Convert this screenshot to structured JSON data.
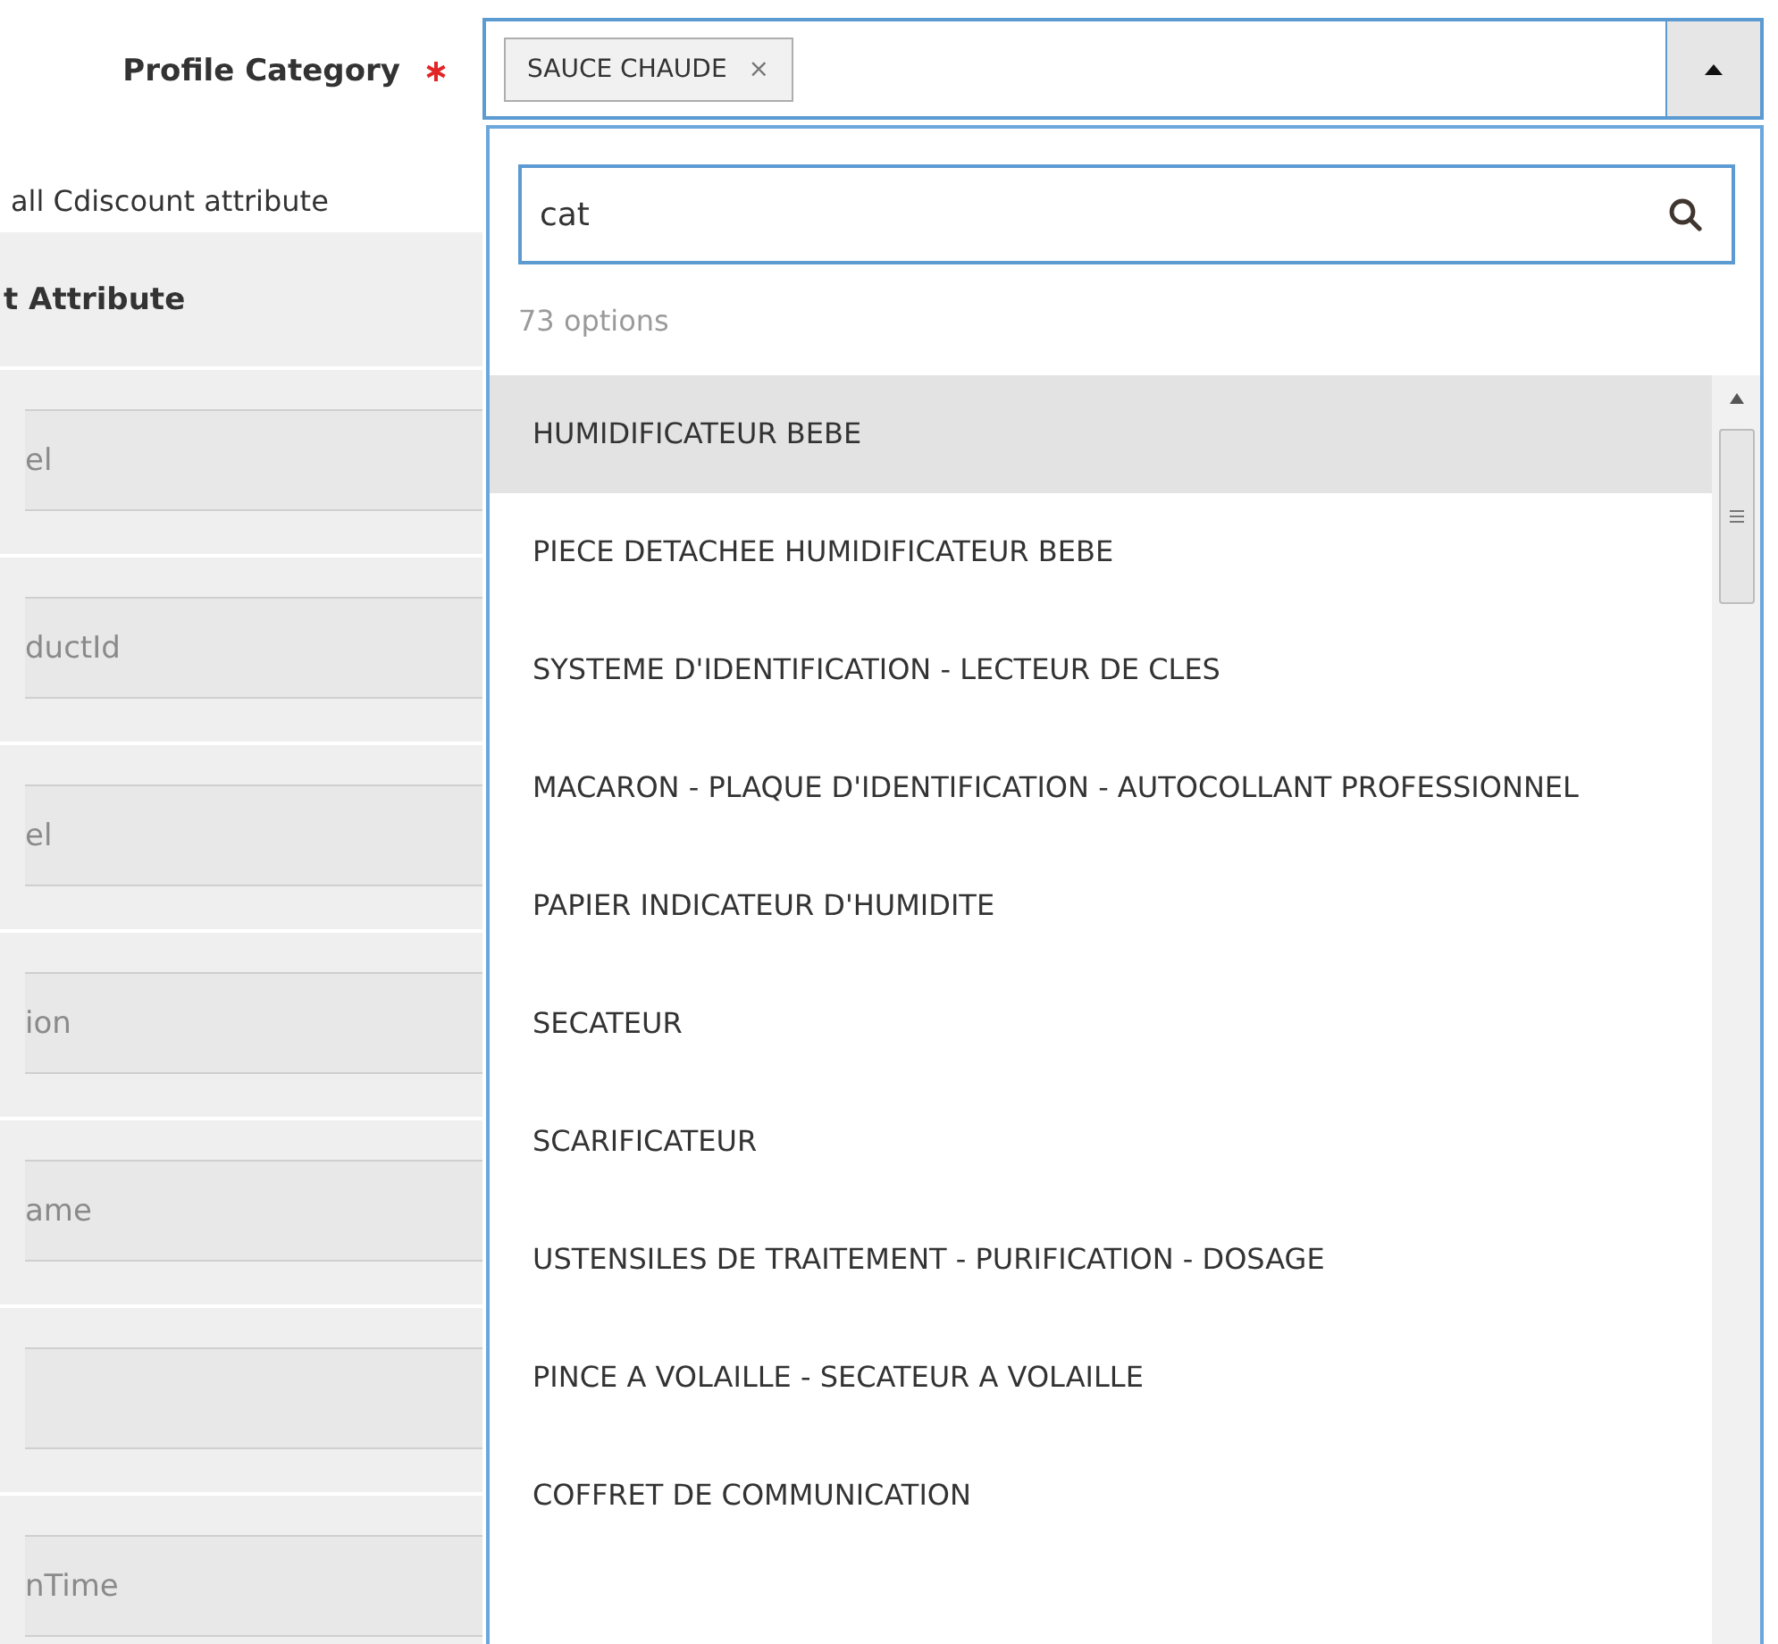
{
  "field": {
    "label": "Profile Category",
    "required": true,
    "expanded": true,
    "tags": [
      {
        "text": "SAUCE CHAUDE",
        "remove": "×"
      }
    ]
  },
  "search": {
    "value": "cat"
  },
  "count": "73 options",
  "options": [
    {
      "text": "HUMIDIFICATEUR BEBE",
      "selected": true
    },
    {
      "text": "PIECE DETACHEE HUMIDIFICATEUR BEBE",
      "selected": false
    },
    {
      "text": "SYSTEME D'IDENTIFICATION - LECTEUR DE CLES",
      "selected": false
    },
    {
      "text": "MACARON - PLAQUE D'IDENTIFICATION - AUTOCOLLANT PROFESSIONNEL",
      "selected": false
    },
    {
      "text": "PAPIER INDICATEUR D'HUMIDITE",
      "selected": false
    },
    {
      "text": "SECATEUR",
      "selected": false
    },
    {
      "text": "SCARIFICATEUR",
      "selected": false
    },
    {
      "text": "USTENSILES DE TRAITEMENT - PURIFICATION - DOSAGE",
      "selected": false
    },
    {
      "text": "PINCE A VOLAILLE - SECATEUR A VOLAILLE",
      "selected": false
    },
    {
      "text": "COFFRET DE COMMUNICATION",
      "selected": false
    }
  ],
  "background": {
    "note": "all Cdiscount attribute",
    "header": "t Attribute",
    "rows": [
      {
        "kind": "text",
        "placeholder": "el"
      },
      {
        "kind": "text",
        "placeholder": "ductId"
      },
      {
        "kind": "text",
        "placeholder": "el"
      },
      {
        "kind": "text",
        "placeholder": "ion"
      },
      {
        "kind": "text",
        "placeholder": "ame"
      },
      {
        "kind": "empty"
      },
      {
        "kind": "text",
        "placeholder": "nTime"
      }
    ]
  }
}
